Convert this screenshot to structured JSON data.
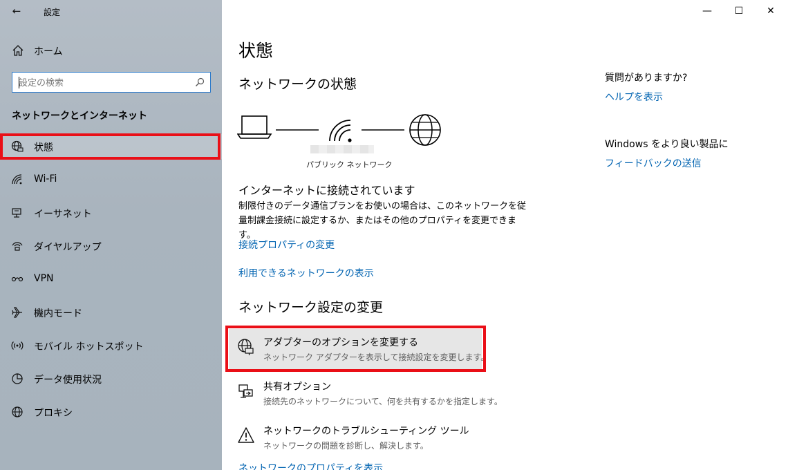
{
  "window": {
    "title": "設定",
    "back_glyph": "←",
    "minimize_glyph": "—",
    "maximize_glyph": "☐",
    "close_glyph": "✕"
  },
  "sidebar": {
    "home_label": "ホーム",
    "search_placeholder": "設定の検索",
    "section_heading": "ネットワークとインターネット",
    "items": [
      {
        "label": "状態",
        "icon": "globe-status-icon",
        "selected": true
      },
      {
        "label": "Wi-Fi",
        "icon": "wifi-icon"
      },
      {
        "label": "イーサネット",
        "icon": "ethernet-icon"
      },
      {
        "label": "ダイヤルアップ",
        "icon": "dialup-icon"
      },
      {
        "label": "VPN",
        "icon": "vpn-icon"
      },
      {
        "label": "機内モード",
        "icon": "airplane-icon"
      },
      {
        "label": "モバイル ホットスポット",
        "icon": "hotspot-icon"
      },
      {
        "label": "データ使用状況",
        "icon": "data-usage-icon"
      },
      {
        "label": "プロキシ",
        "icon": "proxy-globe-icon"
      }
    ]
  },
  "main": {
    "page_title": "状態",
    "network_status_title": "ネットワークの状態",
    "network_label": "パブリック ネットワーク",
    "connected_title": "インターネットに接続されています",
    "connected_desc": "制限付きのデータ通信プランをお使いの場合は、このネットワークを従量制課金接続に設定するか、またはその他のプロパティを変更できます。",
    "link_change_props": "接続プロパティの変更",
    "link_show_networks": "利用できるネットワークの表示",
    "settings_title": "ネットワーク設定の変更",
    "settings": [
      {
        "title": "アダプターのオプションを変更する",
        "desc": "ネットワーク アダプターを表示して接続設定を変更します。",
        "icon": "adapter-globe-icon",
        "highlighted": true
      },
      {
        "title": "共有オプション",
        "desc": "接続先のネットワークについて、何を共有するかを指定します。",
        "icon": "sharing-icon"
      },
      {
        "title": "ネットワークのトラブルシューティング ツール",
        "desc": "ネットワークの問題を診断し、解決します。",
        "icon": "warning-icon"
      }
    ],
    "link_network_props": "ネットワークのプロパティを表示"
  },
  "right_panel": {
    "question": "質問がありますか?",
    "help_link": "ヘルプを表示",
    "better_heading": "Windows をより良い製品に",
    "feedback_link": "フィードバックの送信"
  },
  "colors": {
    "accent": "#0063b1",
    "highlight_border": "#ea0f17",
    "sidebar_bg": "#aab5bf"
  }
}
